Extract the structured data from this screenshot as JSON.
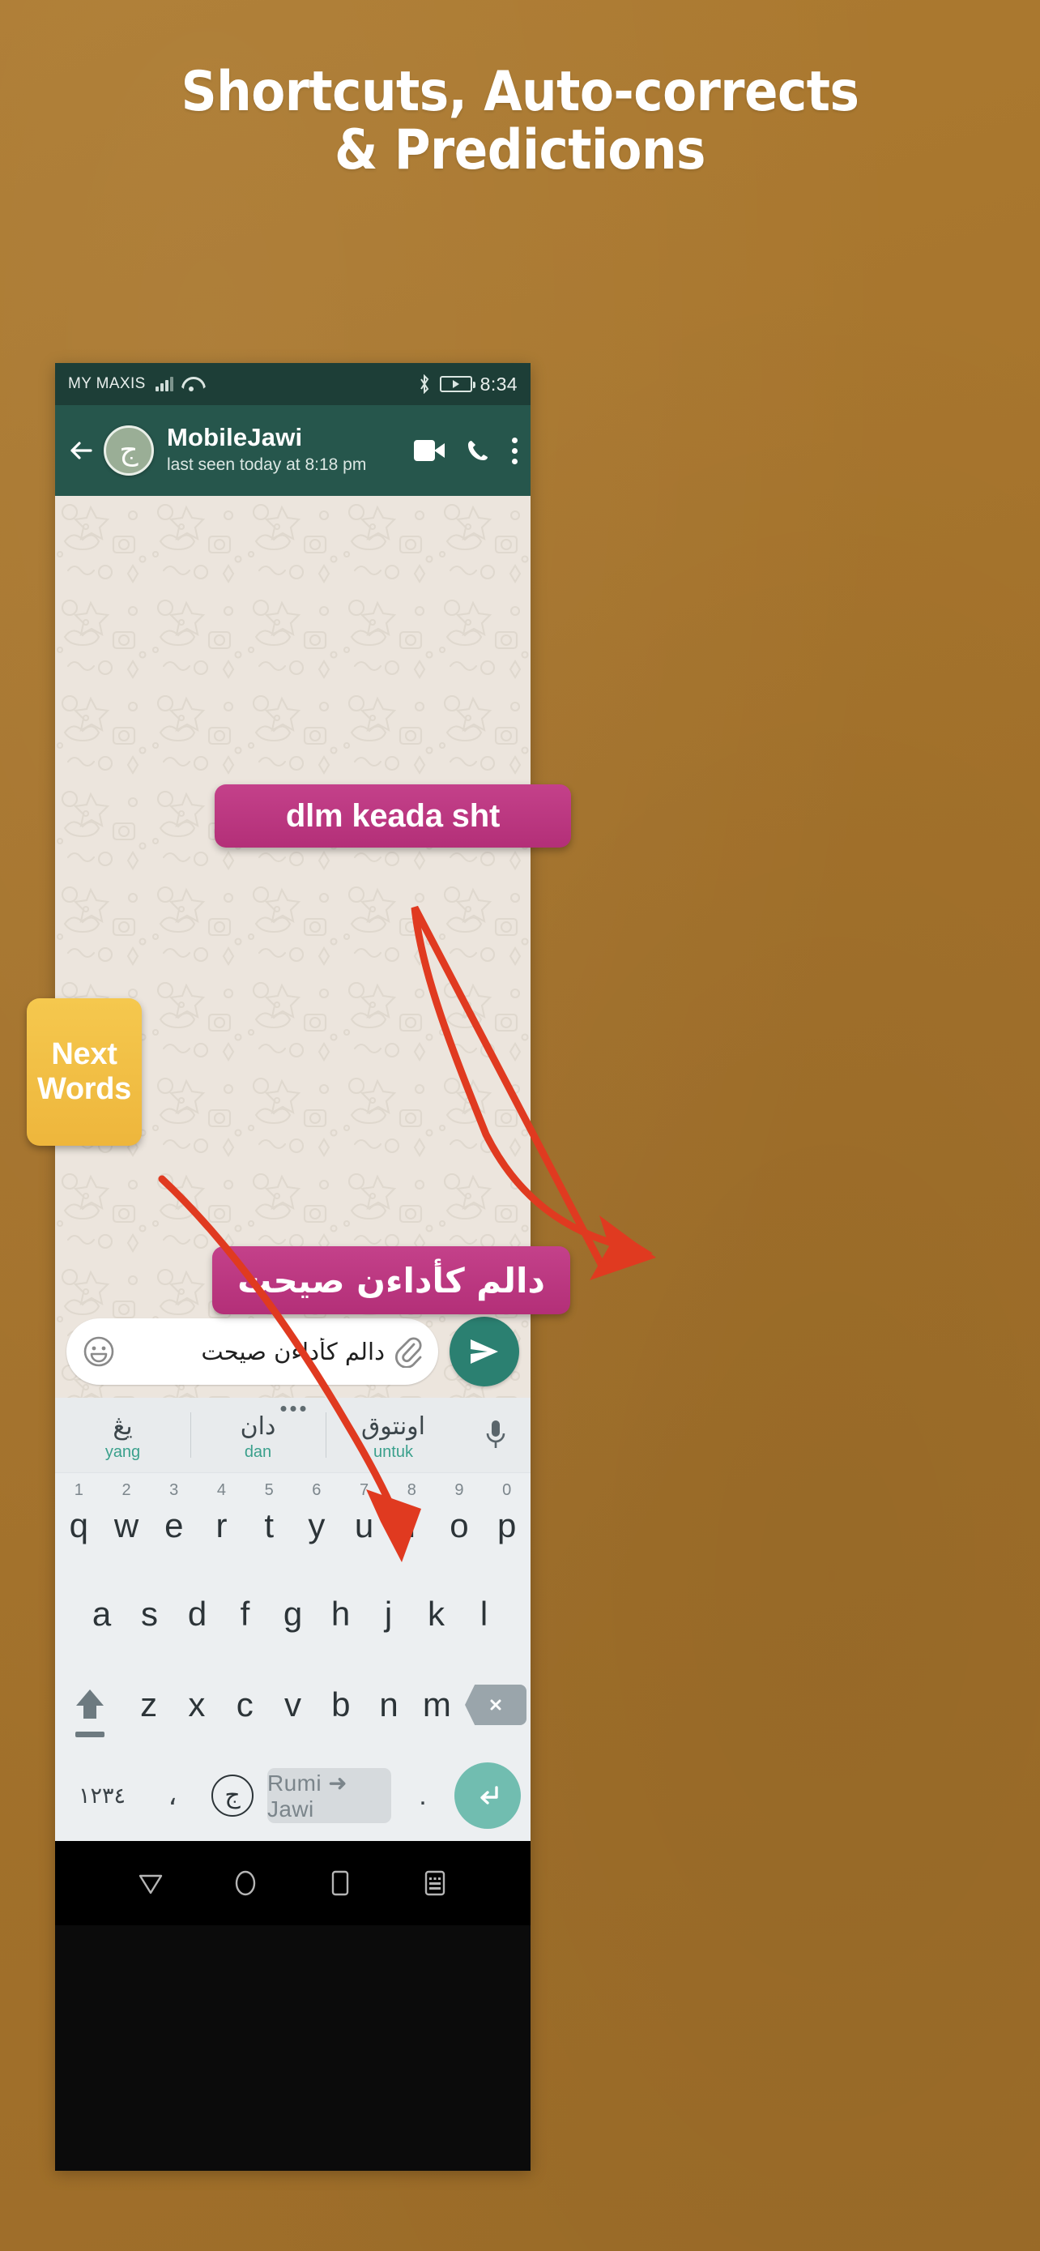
{
  "poster": {
    "headline_line1": "Shortcuts, Auto-corrects",
    "headline_line2": "& Predictions",
    "background_color": "#a8762e"
  },
  "status_bar": {
    "carrier": "MY MAXIS",
    "time": "8:34",
    "signal_icon": "signal-bars-icon",
    "wifi_icon": "wifi-icon",
    "bluetooth_icon": "bluetooth-icon",
    "battery_icon": "battery-charging-icon"
  },
  "chat_header": {
    "back_icon": "back-arrow-icon",
    "avatar_glyph": "ج",
    "contact_name": "MobileJawi",
    "status_text": "last seen today at 8:18 pm",
    "video_icon": "video-call-icon",
    "call_icon": "phone-call-icon",
    "menu_icon": "overflow-menu-icon",
    "header_color": "#26564c"
  },
  "annotations": {
    "callout_1": "dlm keada sht",
    "callout_2": "دالم كأداءن صيحت",
    "badge_next_words": "Next Words",
    "callout_color": "#bf3883",
    "badge_color": "#f2c045",
    "arrow_color": "#e03a20"
  },
  "input_bar": {
    "emoji_icon": "emoji-smiley-icon",
    "message_value": "دالم كأداءن صيحت",
    "attach_icon": "paperclip-icon",
    "send_icon": "send-icon",
    "send_color": "#2b8071"
  },
  "keyboard": {
    "predictions": [
      {
        "jawi": "يڠ",
        "rumi": "yang"
      },
      {
        "jawi": "دان",
        "rumi": "dan"
      },
      {
        "jawi": "اونتوق",
        "rumi": "untuk"
      }
    ],
    "mic_icon": "microphone-icon",
    "more_dots_icon": "more-dots-icon",
    "row1": [
      {
        "letter": "q",
        "num": "1"
      },
      {
        "letter": "w",
        "num": "2"
      },
      {
        "letter": "e",
        "num": "3"
      },
      {
        "letter": "r",
        "num": "4"
      },
      {
        "letter": "t",
        "num": "5"
      },
      {
        "letter": "y",
        "num": "6"
      },
      {
        "letter": "u",
        "num": "7"
      },
      {
        "letter": "i",
        "num": "8"
      },
      {
        "letter": "o",
        "num": "9"
      },
      {
        "letter": "p",
        "num": "0"
      }
    ],
    "row2": [
      "a",
      "s",
      "d",
      "f",
      "g",
      "h",
      "j",
      "k",
      "l"
    ],
    "row3": [
      "z",
      "x",
      "c",
      "v",
      "b",
      "n",
      "m"
    ],
    "shift_icon": "shift-key-icon",
    "backspace_icon": "backspace-icon",
    "row4": {
      "numeric_key": "١٢٣٤",
      "comma_key": "،",
      "jawi_key_glyph": "ج",
      "spacebar_label": "Rumi ➜ Jawi",
      "period_key": ".",
      "enter_icon": "enter-key-icon",
      "enter_color": "#71bdb0"
    }
  },
  "nav_bar": {
    "back_icon": "nav-back-icon",
    "home_icon": "nav-home-icon",
    "recents_icon": "nav-recents-icon",
    "keyboard_icon": "nav-keyboard-icon"
  }
}
